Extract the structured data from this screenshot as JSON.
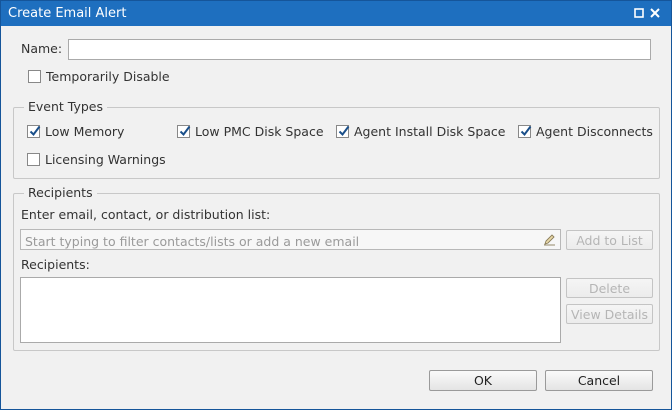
{
  "window": {
    "title": "Create Email Alert"
  },
  "form": {
    "name_label": "Name:",
    "name_value": "",
    "temp_disable_label": "Temporarily Disable"
  },
  "event_types": {
    "legend": "Event Types",
    "items": [
      {
        "label": "Low Memory",
        "checked": true
      },
      {
        "label": "Low PMC Disk Space",
        "checked": true
      },
      {
        "label": "Agent Install Disk Space",
        "checked": true
      },
      {
        "label": "Agent Disconnects",
        "checked": true
      },
      {
        "label": "Licensing Warnings",
        "checked": false
      }
    ]
  },
  "recipients": {
    "legend": "Recipients",
    "entry_label": "Enter email, contact, or distribution list:",
    "search_placeholder": "Start typing to filter contacts/lists or add a new email",
    "add_button": "Add to List",
    "list_label": "Recipients:",
    "delete_button": "Delete",
    "view_details_button": "View Details"
  },
  "footer": {
    "ok": "OK",
    "cancel": "Cancel"
  },
  "colors": {
    "titlebar": "#1e6fbf",
    "check": "#1a4f8a"
  }
}
